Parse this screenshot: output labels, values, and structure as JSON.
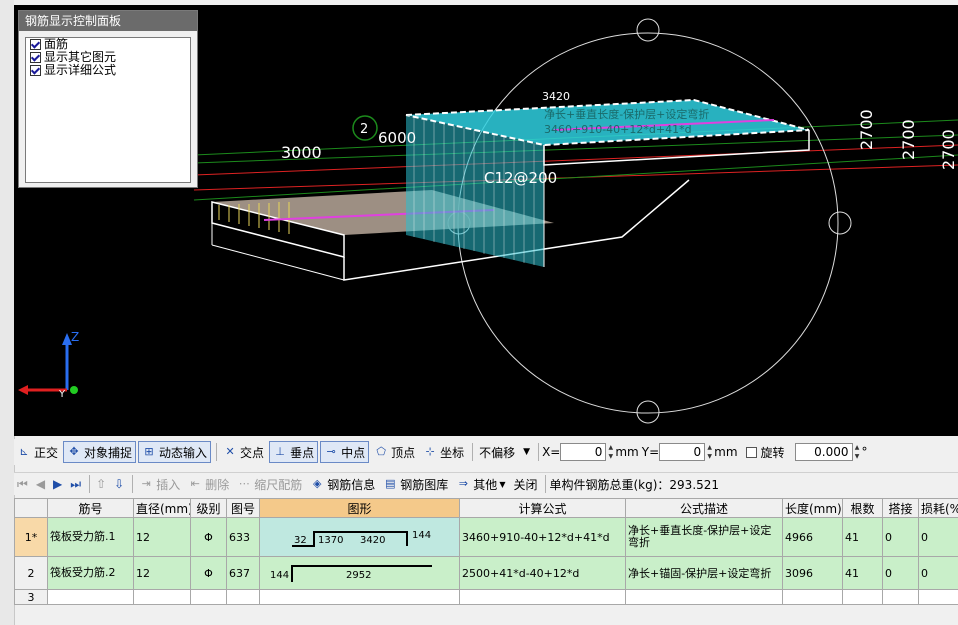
{
  "panel": {
    "title": "钢筋显示控制面板",
    "options": [
      "面筋",
      "显示其它图元",
      "显示详细公式"
    ]
  },
  "viewport": {
    "labels": {
      "dim_3000": "3000",
      "dim_6000": "6000",
      "axis_2": "2",
      "dim_3420": "3420",
      "dim_2700_a": "2700",
      "dim_2700_b": "2700",
      "dim_2700_c": "2700",
      "rebar_note": "C12@200",
      "formula_desc": "净长+垂直长度-保护层+设定弯折",
      "formula": "3460+910-40+12*d+41*d",
      "axis_z": "Z",
      "axis_y": "Y"
    }
  },
  "toolbar1": {
    "orthogonal": "正交",
    "object_snap": "对象捕捉",
    "dynamic_input": "动态输入",
    "intersection": "交点",
    "perpendicular": "垂点",
    "midpoint": "中点",
    "vertex": "顶点",
    "coordinate": "坐标",
    "offset_mode": "不偏移",
    "x_label": "X=",
    "x_value": "0",
    "x_unit": "mm",
    "y_label": "Y=",
    "y_value": "0",
    "y_unit": "mm",
    "rotate": "旋转",
    "rotate_value": "0.000",
    "degree": "°"
  },
  "toolbar2": {
    "insert": "插入",
    "delete": "删除",
    "scale_rebar": "缩尺配筋",
    "rebar_info": "钢筋信息",
    "rebar_library": "钢筋图库",
    "other": "其他",
    "close": "关闭",
    "total_weight": "单构件钢筋总重(kg)：293.521"
  },
  "table": {
    "headers": [
      "",
      "筋号",
      "直径(mm)",
      "级别",
      "图号",
      "图形",
      "计算公式",
      "公式描述",
      "长度(mm)",
      "根数",
      "搭接",
      "损耗(%)"
    ],
    "rows": [
      {
        "idx": "1*",
        "name": "筏板受力筋.1",
        "dia": "12",
        "grade": "Φ",
        "fig": "633",
        "shape": {
          "a": "32",
          "b": "1370",
          "c": "3420",
          "d": "144"
        },
        "formula": "3460+910-40+12*d+41*d",
        "desc": "净长+垂直长度-保护层+设定弯折",
        "length": "4966",
        "count": "41",
        "lap": "0",
        "loss": "0"
      },
      {
        "idx": "2",
        "name": "筏板受力筋.2",
        "dia": "12",
        "grade": "Φ",
        "fig": "637",
        "shape": {
          "a": "144",
          "b": "2952"
        },
        "formula": "2500+41*d-40+12*d",
        "desc": "净长+锚固-保护层+设定弯折",
        "length": "3096",
        "count": "41",
        "lap": "0",
        "loss": "0"
      },
      {
        "idx": "3"
      }
    ]
  }
}
